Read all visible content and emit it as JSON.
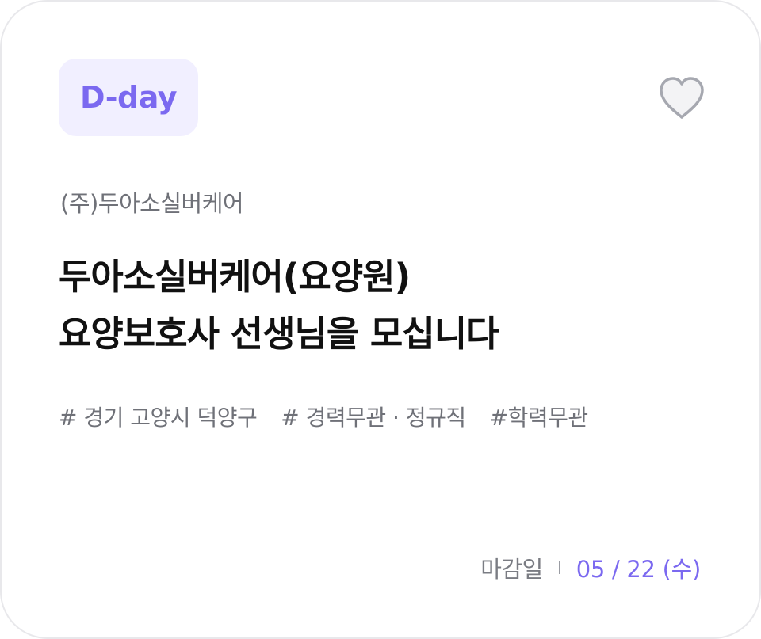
{
  "badge": {
    "label": "D-day"
  },
  "favorite": {
    "icon": "heart-icon"
  },
  "company": "(주)두아소실버케어",
  "title": {
    "line1": "두아소실버케어(요양원)",
    "line2": "요양보호사 선생님을 모십니다"
  },
  "tags": [
    "# 경기 고양시 덕양구",
    "# 경력무관 · 정규직",
    "#학력무관"
  ],
  "deadline": {
    "label": "마감일",
    "date": "05 / 22 (수)"
  },
  "colors": {
    "accent": "#7b69f0",
    "badge_bg": "#f1efff",
    "muted_text": "#6f7178",
    "title_text": "#111111",
    "border": "#e8e8eb"
  }
}
